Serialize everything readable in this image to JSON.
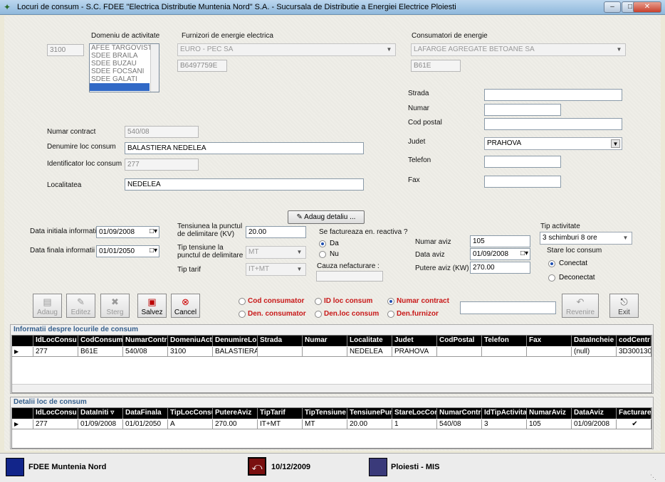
{
  "window": {
    "title": "Locuri de consum - S.C. FDEE \"Electrica Distributie Muntenia Nord\" S.A. - Sucursala de Distributie a Energiei Electrice Ploiesti",
    "min": "–",
    "max": "□",
    "close": "✕"
  },
  "top": {
    "domain_id": "3100",
    "domain_label": "Domeniu de activitate",
    "domain_items": [
      "AFEE TARGOVISTE",
      "SDEE BRAILA",
      "SDEE BUZAU",
      "SDEE FOCSANI",
      "SDEE GALATI",
      ""
    ],
    "supplier_label": "Furnizori de energie electrica",
    "supplier_value": "EURO - PEC SA",
    "supplier_code": "B6497759E",
    "consumer_label": "Consumatori de energie",
    "consumer_value": "LAFARGE AGREGATE BETOANE SA",
    "consumer_code": "B61E"
  },
  "address": {
    "strada_label": "Strada",
    "strada": "",
    "numar_label": "Numar",
    "numar": "",
    "cod_label": "Cod postal",
    "cod": "",
    "judet_label": "Judet",
    "judet": "PRAHOVA",
    "telefon_label": "Telefon",
    "telefon": "",
    "fax_label": "Fax",
    "fax": ""
  },
  "contract": {
    "nr_label": "Numar contract",
    "nr": "540/08",
    "den_label": "Denumire loc consum",
    "den": "BALASTIERA NEDELEA",
    "id_label": "Identificator loc consum",
    "id": "277",
    "loc_label": "Localitatea",
    "loc": "NEDELEA"
  },
  "details": {
    "add_btn": "Adaug detaliu ...",
    "di_label": "Data initiala informatii",
    "di": "01/09/2008",
    "df_label": "Data finala informatii",
    "df": "01/01/2050",
    "tens_label_1": "Tensiunea la punctul",
    "tens_label_2": "de delimitare (KV)",
    "tens": "20.00",
    "tt_label_1": "Tip tensiune la",
    "tt_label_2": "punctul de delimitare",
    "tt": "MT",
    "tarif_label": "Tip tarif",
    "tarif": "IT+MT",
    "fact_label": "Se factureaza en. reactiva ?",
    "da": "Da",
    "nu": "Nu",
    "cauza_label": "Cauza nefacturare :",
    "aviz_label": "Numar aviz",
    "aviz": "105",
    "daviz_label": "Data aviz",
    "daviz": "01/09/2008",
    "paviz_label": "Putere aviz (KW)",
    "paviz": "270.00",
    "tipact_label": "Tip activitate",
    "tipact": "3 schimburi 8 ore",
    "stare_label": "Stare loc consum",
    "conectat": "Conectat",
    "deconectat": "Deconectat"
  },
  "toolbar": {
    "adaug": "Adaug",
    "editez": "Editez",
    "sterg": "Sterg",
    "salvez": "Salvez",
    "cancel": "Cancel",
    "revenire": "Revenire",
    "exit": "Exit"
  },
  "search": {
    "cod_cons": "Cod consumator",
    "id_loc": "ID loc consum",
    "nr_contract": "Numar contract",
    "den_cons": "Den. consumator",
    "den_loc": "Den.loc consum",
    "den_furn": "Den.furnizor",
    "value": ""
  },
  "grid1": {
    "title": "Informatii despre locurile de consum",
    "headers": [
      "IdLocConsu",
      "CodConsum",
      "NumarContr",
      "DomeniuActi",
      "DenumireLo",
      "Strada",
      "Numar",
      "Localitate",
      "Judet",
      "CodPostal",
      "Telefon",
      "Fax",
      "DataIncheie",
      "codCentr"
    ],
    "row": [
      "277",
      "B61E",
      "540/08",
      "3100",
      "BALASTIERA",
      "",
      "",
      "NEDELEA",
      "PRAHOVA",
      "",
      "",
      "",
      "(null)",
      "3D300130"
    ]
  },
  "grid2": {
    "title": "Detalii loc de consum",
    "headers": [
      "IdLocConsu",
      "DataIniti ▿",
      "DataFinala",
      "TipLocConsu",
      "PutereAviz",
      "TipTarif",
      "TipTensiune",
      "TensiunePun",
      "StareLocCon",
      "NumarContr",
      "IdTipActivita",
      "NumarAviz",
      "DataAviz",
      "Facturare"
    ],
    "row": [
      "277",
      "01/09/2008",
      "01/01/2050",
      "A",
      "270.00",
      "IT+MT",
      "MT",
      "20.00",
      "1",
      "540/08",
      "3",
      "105",
      "01/09/2008",
      "✔"
    ]
  },
  "status": {
    "company": "FDEE Muntenia Nord",
    "date": "10/12/2009",
    "place": "Ploiesti - MIS"
  }
}
